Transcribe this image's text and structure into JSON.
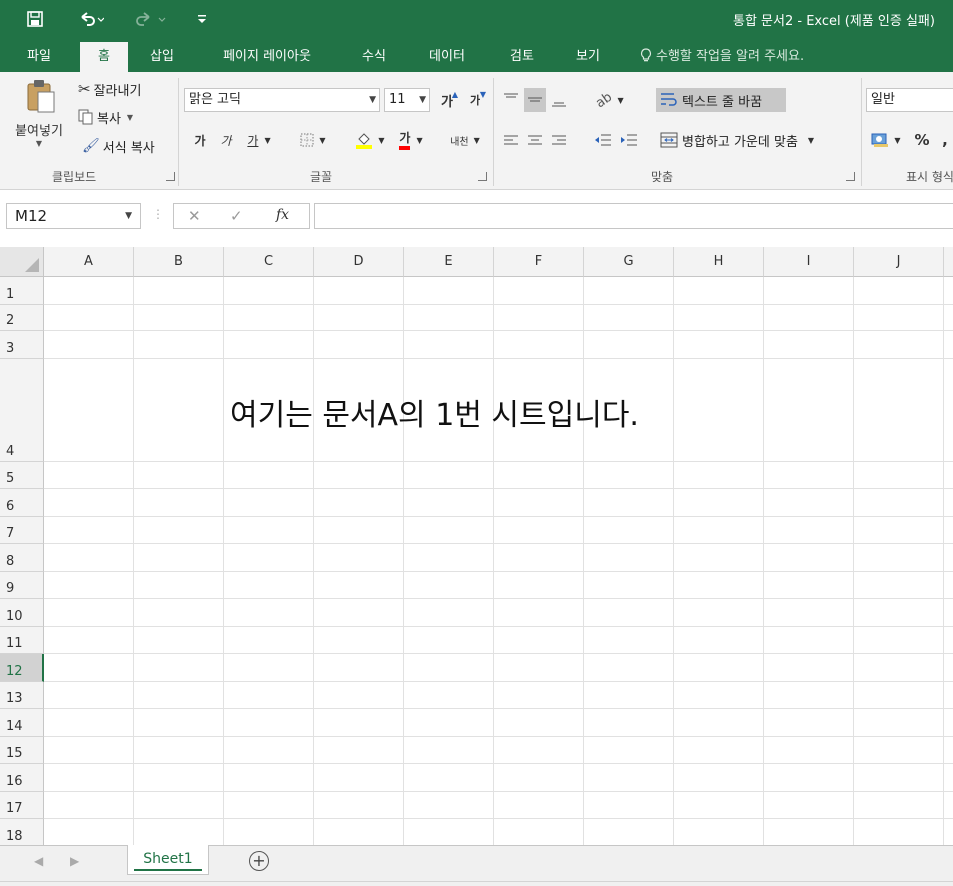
{
  "titlebar": {
    "title": "통합 문서2 - Excel (제품 인증 실패)",
    "save_icon": "save-icon",
    "undo_icon": "undo-icon",
    "redo_icon": "redo-icon",
    "customize_icon": "customize-quick-access-icon"
  },
  "menu": {
    "tabs": [
      "파일",
      "홈",
      "삽입",
      "페이지 레이아웃",
      "수식",
      "데이터",
      "검토",
      "보기"
    ],
    "active": "홈",
    "tell_me": "수행할 작업을 알려 주세요."
  },
  "ribbon": {
    "clipboard": {
      "paste": "붙여넣기",
      "cut": "잘라내기",
      "copy": "복사",
      "format_painter": "서식 복사",
      "label": "클립보드"
    },
    "font": {
      "font_name": "맑은 고딕",
      "font_size": "11",
      "grow": "가",
      "shrink": "가",
      "bold": "가",
      "italic": "가",
      "underline": "가",
      "font_color": "가",
      "phonetic": "내천",
      "label": "글꼴",
      "highlight_color": "#ffff00",
      "text_color": "#ff0000"
    },
    "alignment": {
      "wrap_text": "텍스트 줄 바꿈",
      "merge_center": "병합하고 가운데 맞춤",
      "label": "맞춤"
    },
    "number": {
      "format": "일반",
      "percent": "%",
      "comma": ",",
      "label": "표시 형식"
    }
  },
  "formula_bar": {
    "name_box": "M12",
    "cancel": "✕",
    "enter": "✓",
    "fx": "fx",
    "value": ""
  },
  "grid": {
    "columns": [
      "A",
      "B",
      "C",
      "D",
      "E",
      "F",
      "G",
      "H",
      "I",
      "J"
    ],
    "rows": [
      "1",
      "2",
      "3",
      "4",
      "5",
      "6",
      "7",
      "8",
      "9",
      "10",
      "11",
      "12",
      "13",
      "14",
      "15",
      "16",
      "17",
      "18"
    ],
    "selected_row": "12",
    "cell_text": "여기는 문서A의 1번 시트입니다."
  },
  "sheets": {
    "tabs": [
      "Sheet1"
    ],
    "active": "Sheet1",
    "add": "+"
  },
  "colors": {
    "accent": "#217346",
    "ribbon_bg": "#f3f3f3"
  }
}
